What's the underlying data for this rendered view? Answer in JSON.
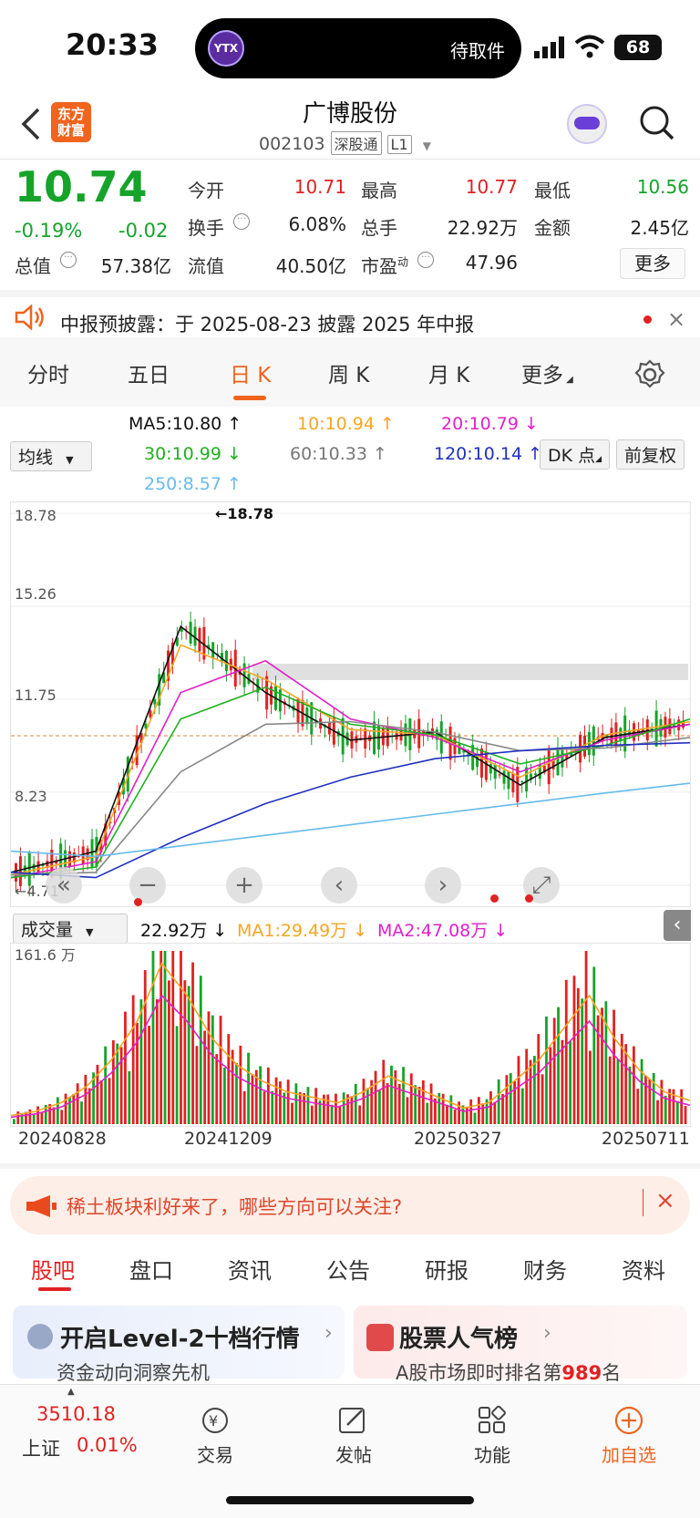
{
  "status_bar": {
    "time": "20:33",
    "island_label": "待取件",
    "island_logo": "YTX",
    "battery": "68"
  },
  "header": {
    "back": "‹",
    "logo_line1": "东方",
    "logo_line2": "财富",
    "title": "广博股份",
    "code": "002103",
    "tag1": "深股通",
    "tag2": "L1"
  },
  "quote": {
    "price": "10.74",
    "change_pct": "-0.19%",
    "change": "-0.02",
    "open_label": "今开",
    "open": "10.71",
    "high_label": "最高",
    "high": "10.77",
    "low_label": "最低",
    "low": "10.56",
    "turnover_label": "换手",
    "turnover": "6.08%",
    "volume_label": "总手",
    "volume": "22.92万",
    "amount_label": "金额",
    "amount": "2.45亿",
    "mcap_label": "总值",
    "mcap": "57.38亿",
    "float_label": "流值",
    "float": "40.50亿",
    "pe_label": "市盈",
    "pe_sup": "动",
    "pe": "47.96",
    "more": "更多"
  },
  "notice": {
    "text": "中报预披露：于 2025-08-23 披露 2025 年中报",
    "close": "×"
  },
  "chart_tabs": [
    "分时",
    "五日",
    "日 K",
    "周 K",
    "月 K",
    "更多"
  ],
  "active_tab": 2,
  "ma": {
    "selector": "均线",
    "ma5": "MA5:10.80 ↑",
    "ma10": "10:10.94 ↑",
    "ma20": "20:10.79 ↓",
    "ma30": "30:10.99 ↓",
    "ma60": "60:10.33 ↑",
    "ma120": "120:10.14 ↑",
    "ma250": "250:8.57 ↑",
    "dk": "DK 点",
    "adjust": "前复权"
  },
  "colors": {
    "up": "#e02222",
    "down": "#16a32a",
    "accent": "#f0641e",
    "ma5": "#111111",
    "ma10": "#f5a623",
    "ma20": "#e020c8",
    "ma30": "#20b020",
    "ma60": "#888888",
    "ma120": "#2030c0",
    "ma250": "#66bbee"
  },
  "chart_data": [
    {
      "type": "line",
      "title": "",
      "y_ticks": [
        "18.78",
        "15.26",
        "11.75",
        "8.23",
        "4.71"
      ],
      "ylim": [
        4.71,
        18.78
      ],
      "peak_label": "←18.78",
      "low_label": "←4.71",
      "x": [
        "20240828",
        "20241209",
        "20250327",
        "20250711"
      ],
      "series": [
        {
          "name": "MA5",
          "values": [
            5.2,
            6.0,
            14.5,
            12.0,
            10.2,
            10.5,
            8.5,
            10.3,
            10.8
          ]
        },
        {
          "name": "MA10",
          "values": [
            5.1,
            5.8,
            13.8,
            12.5,
            10.6,
            10.4,
            8.8,
            10.4,
            10.9
          ]
        },
        {
          "name": "MA20",
          "values": [
            5.0,
            5.6,
            12.0,
            13.2,
            11.0,
            10.3,
            9.0,
            10.2,
            10.8
          ]
        },
        {
          "name": "MA30",
          "values": [
            5.0,
            5.4,
            11.0,
            12.2,
            10.8,
            10.4,
            9.3,
            10.0,
            11.0
          ]
        },
        {
          "name": "MA60",
          "values": [
            5.1,
            5.2,
            9.0,
            10.8,
            10.9,
            10.5,
            9.8,
            9.9,
            10.3
          ]
        },
        {
          "name": "MA120",
          "values": [
            5.2,
            5.0,
            6.5,
            7.8,
            8.8,
            9.5,
            9.8,
            10.0,
            10.1
          ]
        },
        {
          "name": "MA250",
          "values": [
            6.0,
            5.8,
            6.2,
            6.6,
            7.0,
            7.4,
            7.8,
            8.2,
            8.57
          ]
        }
      ]
    },
    {
      "type": "bar",
      "title": "成交量",
      "y_max_label": "161.6 万",
      "legend_vol": "22.92万 ↓",
      "legend_ma1": "MA1:29.49万 ↓",
      "legend_ma2": "MA2:47.08万 ↓",
      "x": [
        "20240828",
        "20241209",
        "20250327",
        "20250711"
      ],
      "values": [
        8,
        12,
        20,
        35,
        60,
        95,
        150,
        120,
        80,
        55,
        40,
        30,
        25,
        20,
        30,
        45,
        35,
        25,
        15,
        20,
        40,
        60,
        90,
        120,
        80,
        50,
        30,
        22
      ]
    }
  ],
  "volume_selector": "成交量",
  "ad": {
    "text": "稀土板块利好来了，哪些方向可以关注?",
    "close": "×"
  },
  "bottom_tabs": [
    "股吧",
    "盘口",
    "资讯",
    "公告",
    "研报",
    "财务",
    "资料"
  ],
  "cards": [
    {
      "title": "开启Level-2十档行情",
      "sub": "资金动向洞察先机"
    },
    {
      "title": "股票人气榜",
      "sub_prefix": "A股市场即时排名第",
      "rank": "989",
      "sub_suffix": "名"
    }
  ],
  "nav": {
    "index_value": "3510.18",
    "index_name": "上证",
    "index_change": "0.01%",
    "trade": "交易",
    "post": "发帖",
    "func": "功能",
    "add": "加自选"
  }
}
